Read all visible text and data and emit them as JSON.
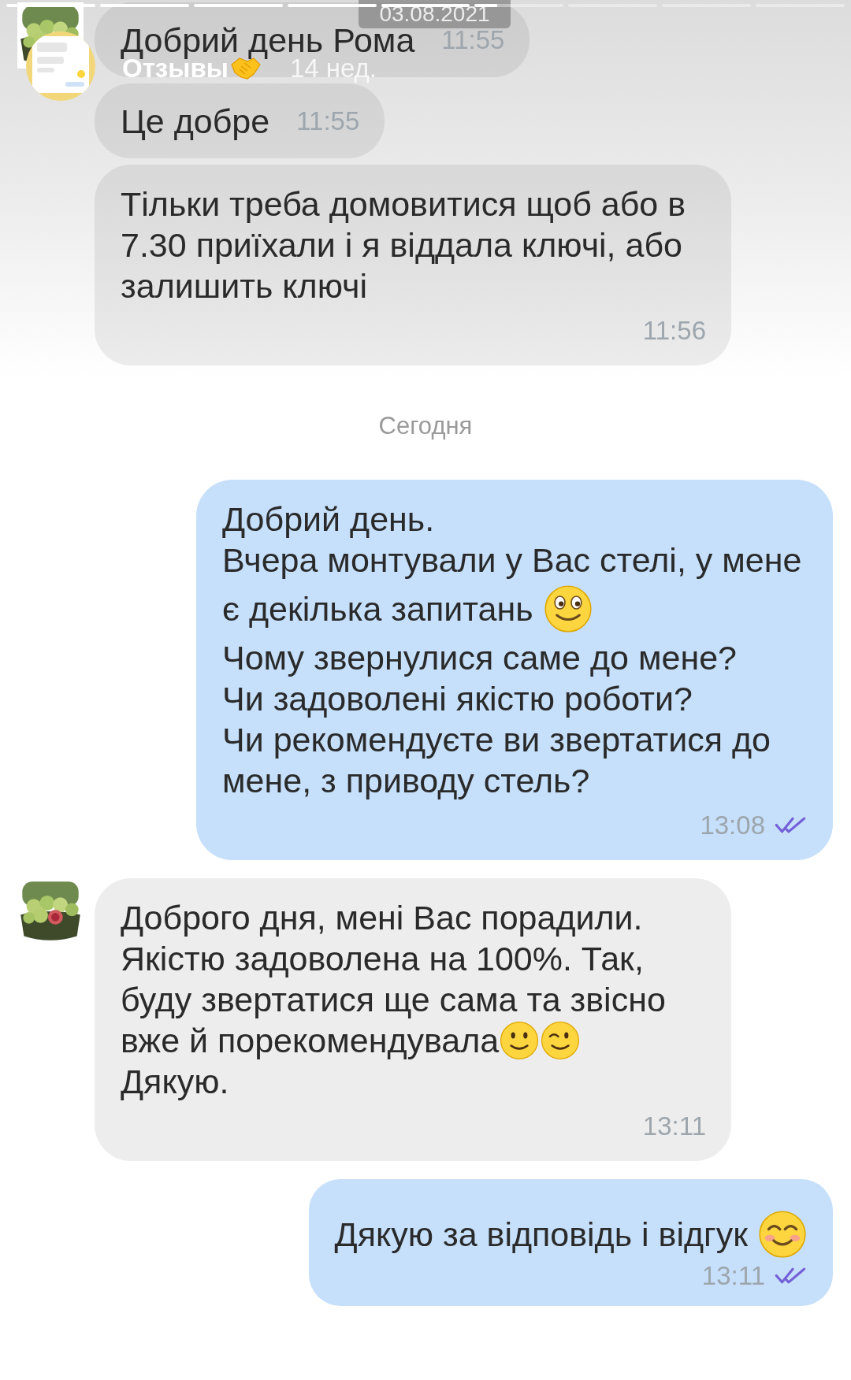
{
  "story": {
    "progress": [
      {
        "level": 1
      },
      {
        "level": 1
      },
      {
        "level": 1
      },
      {
        "level": 1
      },
      {
        "level": 1
      },
      {
        "level": 0.25
      },
      {
        "level": 0
      },
      {
        "level": 0
      },
      {
        "level": 0
      }
    ],
    "title": "Отзывы",
    "age": "14 нед.",
    "date": "03.08.2021"
  },
  "messages": [
    {
      "kind": "in_inline",
      "avatar": true,
      "lines": [
        {
          "text": "Добрий день Рома"
        }
      ],
      "time": "11:55"
    },
    {
      "kind": "in_inline",
      "avatar": false,
      "lines": [
        {
          "text": "Це добре"
        }
      ],
      "time": "11:55"
    },
    {
      "kind": "in_block",
      "avatar": false,
      "lines": [
        {
          "text": "Тільки треба домовитися щоб або в"
        },
        {
          "text": "7.30 приїхали і я віддала ключі, або"
        },
        {
          "text": "залишить ключі"
        }
      ],
      "time": "11:56"
    },
    {
      "kind": "separator",
      "text": "Сегодня"
    },
    {
      "kind": "out_block",
      "read": true,
      "lines": [
        {
          "text": "Добрий день."
        },
        {
          "text": "Вчера монтували у Вас стелі, у мене"
        },
        {
          "text": "є декілька запитань ",
          "emojis": [
            {
              "kind": "smile"
            }
          ]
        },
        {
          "text": "Чому звернулися саме до мене?"
        },
        {
          "text": "Чи задоволені якістю роботи?"
        },
        {
          "text": "Чи рекомендуєте ви звертатися до"
        },
        {
          "text": "мене, з приводу стель?"
        }
      ],
      "time": "13:08"
    },
    {
      "kind": "in_block",
      "avatar": true,
      "lines": [
        {
          "text": "Доброго дня, мені Вас порадили."
        },
        {
          "text": "Якістю задоволена на 100%. Так,"
        },
        {
          "text": "буду звертатися ще сама та звісно"
        },
        {
          "text": "вже й порекомендувала",
          "emojis": [
            {
              "kind": "slight"
            },
            {
              "kind": "wink"
            }
          ]
        },
        {
          "text": "Дякую."
        }
      ],
      "time": "13:11"
    },
    {
      "kind": "out_compact",
      "read": true,
      "lines": [
        {
          "text": "Дякую за відповідь і відгук ",
          "emojis": [
            {
              "kind": "blush"
            }
          ]
        }
      ],
      "time": "13:11"
    }
  ]
}
